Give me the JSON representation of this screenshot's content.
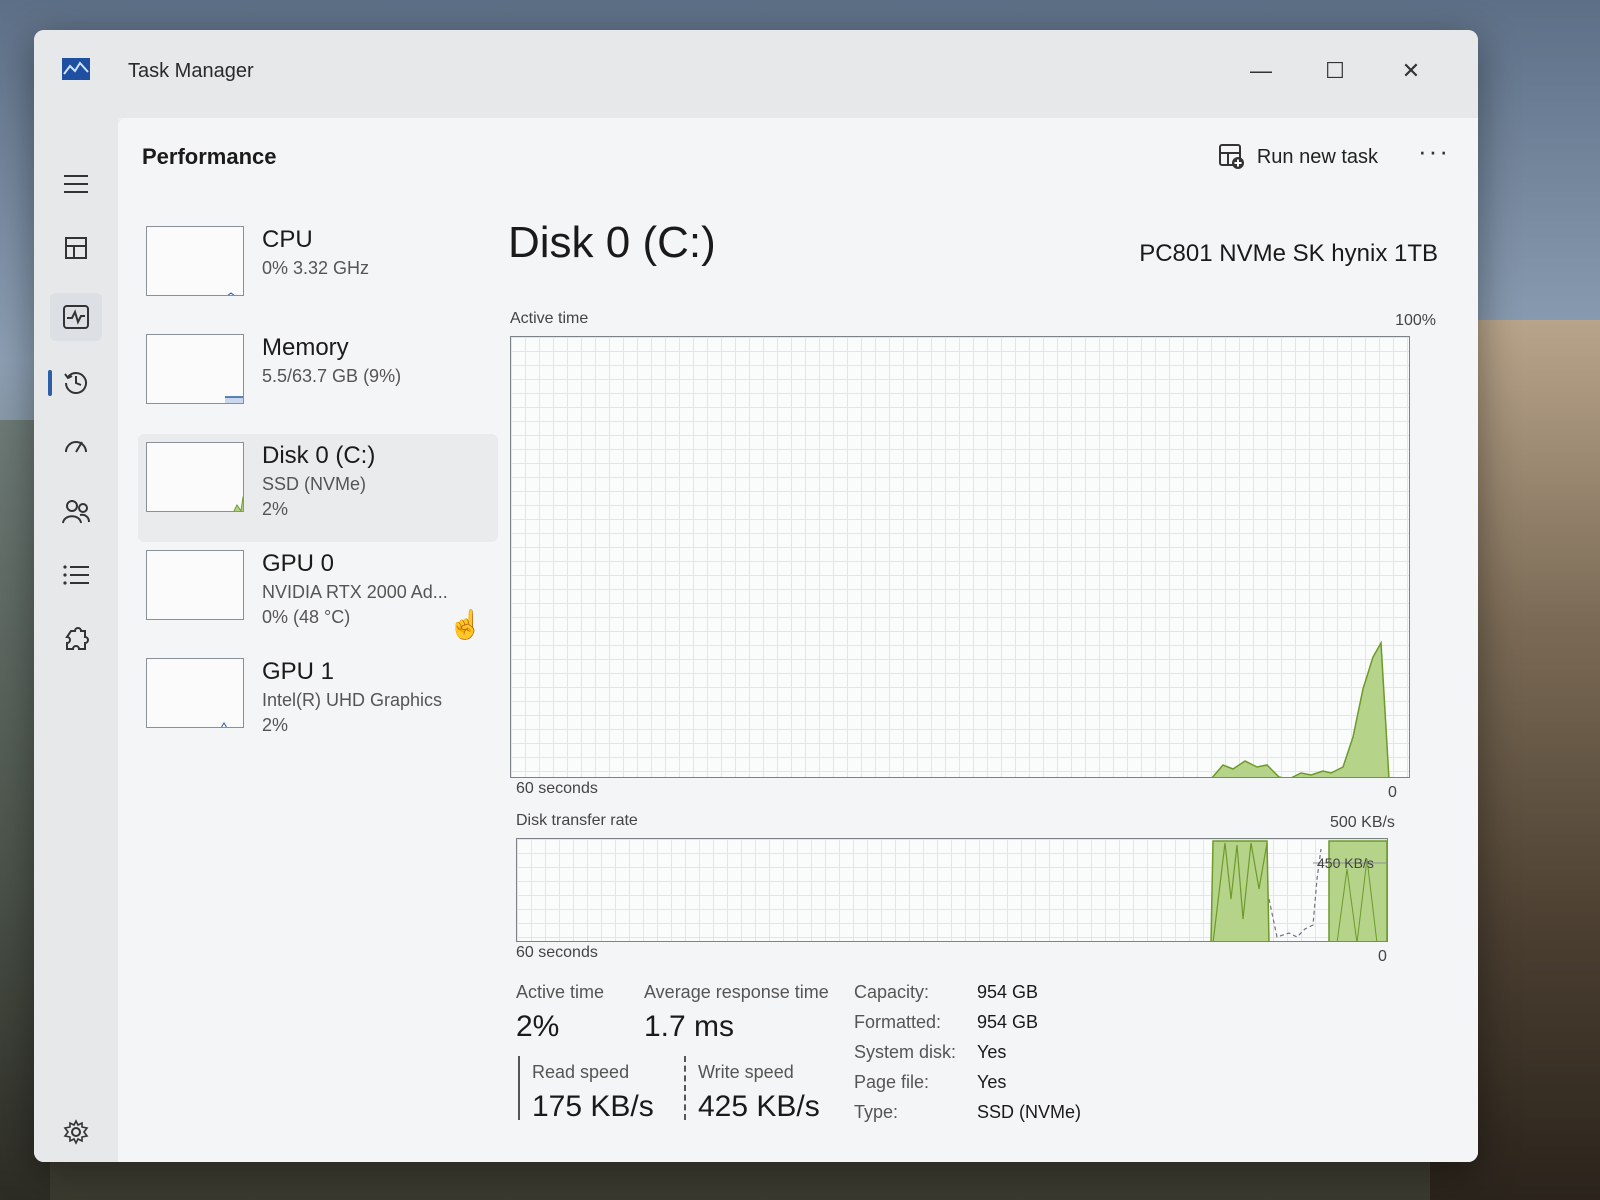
{
  "window": {
    "title": "Task Manager",
    "controls": {
      "minimize": "—",
      "maximize": "☐",
      "close": "✕"
    }
  },
  "header": {
    "page_title": "Performance",
    "run_new_task": "Run new task",
    "more": "···"
  },
  "nav": {
    "items": [
      {
        "name": "hamburger-menu",
        "icon": "menu-icon"
      },
      {
        "name": "processes",
        "icon": "grid-icon"
      },
      {
        "name": "performance",
        "icon": "pulse-icon",
        "active": true
      },
      {
        "name": "app-history",
        "icon": "history-icon"
      },
      {
        "name": "startup-apps",
        "icon": "speedometer-icon"
      },
      {
        "name": "users",
        "icon": "users-icon"
      },
      {
        "name": "details",
        "icon": "list-icon"
      },
      {
        "name": "services",
        "icon": "puzzle-icon"
      }
    ],
    "settings_icon": "gear-icon"
  },
  "devices": [
    {
      "name": "CPU",
      "line1": "0% 3.32 GHz",
      "line2": ""
    },
    {
      "name": "Memory",
      "line1": "5.5/63.7 GB (9%)",
      "line2": ""
    },
    {
      "name": "Disk 0 (C:)",
      "line1": "SSD (NVMe)",
      "line2": "2%",
      "selected": true
    },
    {
      "name": "GPU 0",
      "line1": "NVIDIA RTX 2000 Ad...",
      "line2": "0% (48 °C)"
    },
    {
      "name": "GPU 1",
      "line1": "Intel(R) UHD Graphics",
      "line2": "2%"
    }
  ],
  "main": {
    "title": "Disk 0 (C:)",
    "model": "PC801 NVMe SK hynix 1TB",
    "active_chart": {
      "label": "Active time",
      "max": "100%",
      "x_left": "60 seconds",
      "x_right": "0"
    },
    "transfer_chart": {
      "label": "Disk transfer rate",
      "max": "500 KB/s",
      "mid": "450 KB/s",
      "x_left": "60 seconds",
      "x_right": "0"
    },
    "stats": {
      "active_time_label": "Active time",
      "active_time_value": "2%",
      "avg_response_label": "Average response time",
      "avg_response_value": "1.7 ms",
      "read_label": "Read speed",
      "read_value": "175 KB/s",
      "write_label": "Write speed",
      "write_value": "425 KB/s"
    },
    "properties": [
      {
        "label": "Capacity:",
        "value": "954 GB"
      },
      {
        "label": "Formatted:",
        "value": "954 GB"
      },
      {
        "label": "System disk:",
        "value": "Yes"
      },
      {
        "label": "Page file:",
        "value": "Yes"
      },
      {
        "label": "Type:",
        "value": "SSD (NVMe)"
      }
    ]
  },
  "colors": {
    "disk_fill": "#b6d38a",
    "disk_stroke": "#6d9a2a",
    "memory_line": "#2d5ea8",
    "accent": "#2d5ea8"
  }
}
